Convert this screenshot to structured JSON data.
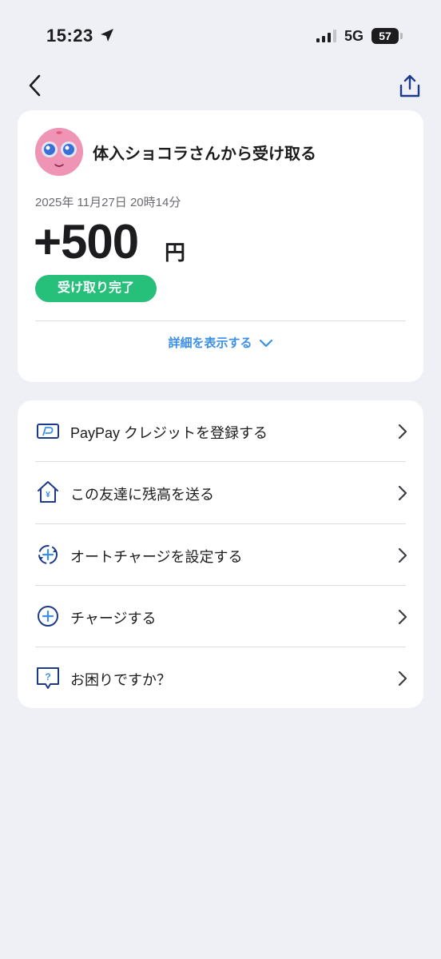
{
  "status_bar": {
    "time": "15:23",
    "network": "5G",
    "battery": "57"
  },
  "transaction": {
    "sender": "体入ショコラさんから受け取る",
    "date": "2025年 11月27日 20時14分",
    "amount": "+500",
    "unit": "円",
    "status": "受け取り完了",
    "details_toggle": "詳細を表示する"
  },
  "menu": {
    "items": [
      {
        "label": "PayPay クレジットを登録する",
        "icon": "credit-card-icon"
      },
      {
        "label": "この友達に残高を送る",
        "icon": "send-home-icon"
      },
      {
        "label": "オートチャージを設定する",
        "icon": "auto-charge-icon"
      },
      {
        "label": "チャージする",
        "icon": "plus-circle-icon"
      },
      {
        "label": "お困りですか？",
        "icon": "help-question-icon"
      }
    ]
  },
  "colors": {
    "background": "#eff0f5",
    "status_green": "#27c07a",
    "link_blue": "#3b8fe8",
    "icon_navy": "#1d3a8a"
  }
}
